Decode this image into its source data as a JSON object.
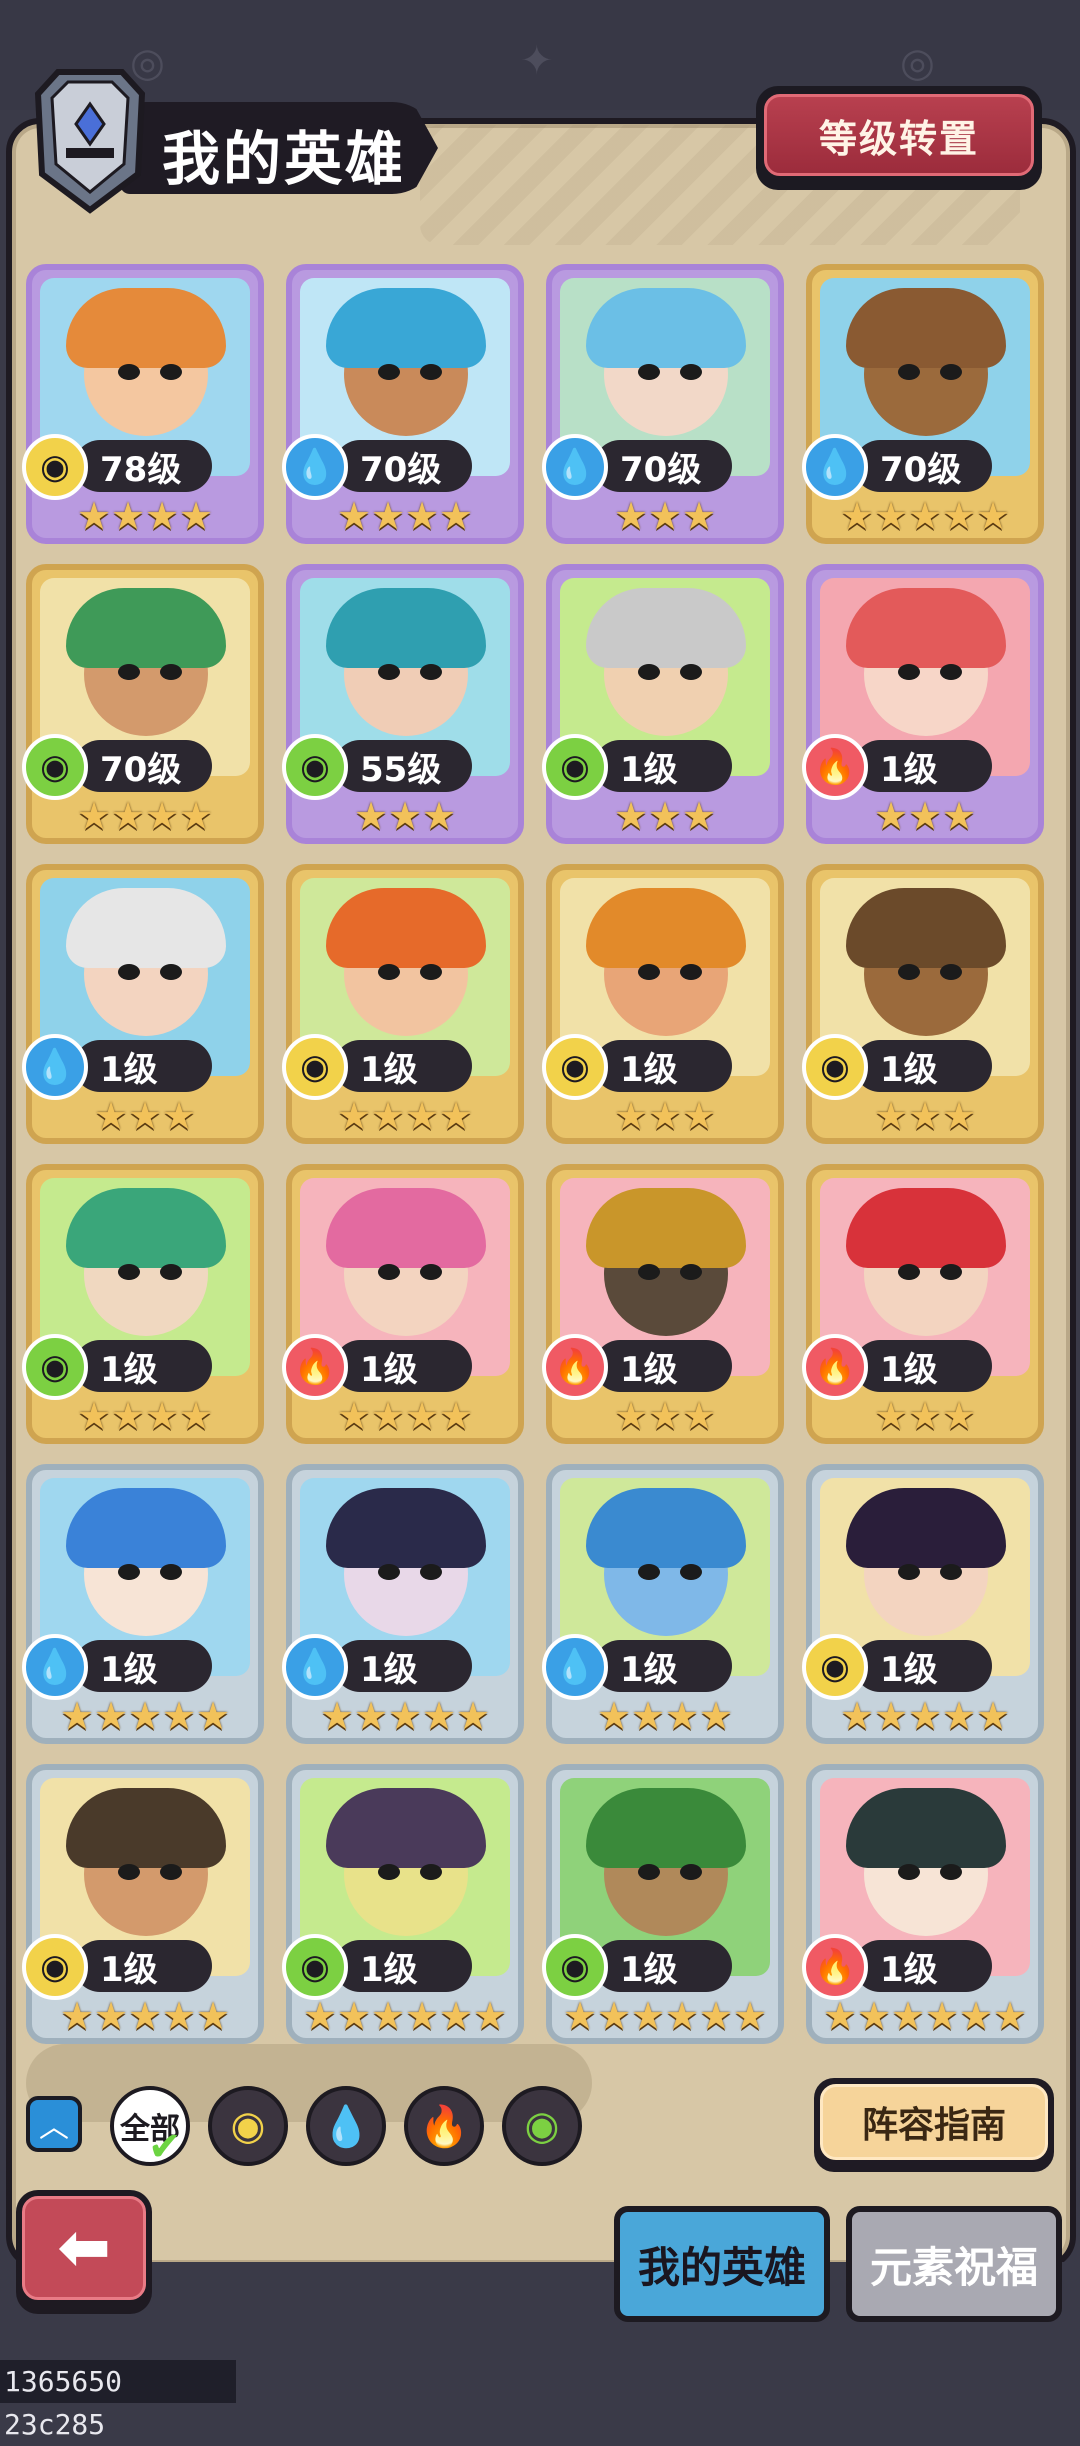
{
  "header": {
    "title": "我的英雄",
    "level_transfer_label": "等级转置"
  },
  "heroes": [
    {
      "level": "78级",
      "element": "earth",
      "stars": 4,
      "frame": "purple",
      "colors": {
        "bg": "#9fd7ef",
        "hair": "#e58a3a",
        "skin": "#f4c7a0"
      }
    },
    {
      "level": "70级",
      "element": "water",
      "stars": 4,
      "frame": "purple",
      "colors": {
        "bg": "#bfe6f6",
        "hair": "#39a7d6",
        "skin": "#c98a5a"
      }
    },
    {
      "level": "70级",
      "element": "water",
      "stars": 3,
      "frame": "purple",
      "colors": {
        "bg": "#b8e0c7",
        "hair": "#6bbfe6",
        "skin": "#f2d8c8"
      }
    },
    {
      "level": "70级",
      "element": "water",
      "stars": 5,
      "frame": "gold",
      "colors": {
        "bg": "#8fd2ea",
        "hair": "#8a5a32",
        "skin": "#9b6a3c"
      }
    },
    {
      "level": "70级",
      "element": "wood",
      "stars": 4,
      "frame": "gold",
      "colors": {
        "bg": "#f1e1a8",
        "hair": "#3f9a58",
        "skin": "#d39a6c"
      }
    },
    {
      "level": "55级",
      "element": "wood",
      "stars": 3,
      "frame": "purple",
      "colors": {
        "bg": "#9fdde9",
        "hair": "#2f9fb0",
        "skin": "#f0cdb6"
      }
    },
    {
      "level": "1级",
      "element": "wood",
      "stars": 3,
      "frame": "purple",
      "colors": {
        "bg": "#c5ea8e",
        "hair": "#c9c9c9",
        "skin": "#f0d0b0"
      }
    },
    {
      "level": "1级",
      "element": "fire",
      "stars": 3,
      "frame": "purple",
      "colors": {
        "bg": "#f4a7b0",
        "hair": "#e35a5a",
        "skin": "#f7d6c8"
      }
    },
    {
      "level": "1级",
      "element": "water",
      "stars": 3,
      "frame": "gold",
      "colors": {
        "bg": "#8fd2ea",
        "hair": "#e6e6e6",
        "skin": "#f3d4c0"
      }
    },
    {
      "level": "1级",
      "element": "earth",
      "stars": 4,
      "frame": "gold",
      "colors": {
        "bg": "#cfe89a",
        "hair": "#e66a2a",
        "skin": "#f2c4a0"
      }
    },
    {
      "level": "1级",
      "element": "earth",
      "stars": 3,
      "frame": "gold",
      "colors": {
        "bg": "#f1e1a8",
        "hair": "#e28a2a",
        "skin": "#e8a577"
      }
    },
    {
      "level": "1级",
      "element": "earth",
      "stars": 3,
      "frame": "gold",
      "colors": {
        "bg": "#f1e1a8",
        "hair": "#6b4a2a",
        "skin": "#9b6a3c"
      }
    },
    {
      "level": "1级",
      "element": "wood",
      "stars": 4,
      "frame": "gold",
      "colors": {
        "bg": "#c5ea8e",
        "hair": "#3aa67a",
        "skin": "#f0d8c0"
      }
    },
    {
      "level": "1级",
      "element": "fire",
      "stars": 4,
      "frame": "gold",
      "colors": {
        "bg": "#f6b4bc",
        "hair": "#e36aa0",
        "skin": "#f3d4c0"
      }
    },
    {
      "level": "1级",
      "element": "fire",
      "stars": 3,
      "frame": "gold",
      "colors": {
        "bg": "#f6b4bc",
        "hair": "#c9962a",
        "skin": "#5a4a3a"
      }
    },
    {
      "level": "1级",
      "element": "fire",
      "stars": 3,
      "frame": "gold",
      "colors": {
        "bg": "#f6b4bc",
        "hair": "#d8323a",
        "skin": "#f3d4c0"
      }
    },
    {
      "level": "1级",
      "element": "water",
      "stars": 5,
      "frame": "silver",
      "colors": {
        "bg": "#9fd7ef",
        "hair": "#3a82d8",
        "skin": "#f7e4d6"
      }
    },
    {
      "level": "1级",
      "element": "water",
      "stars": 5,
      "frame": "silver",
      "colors": {
        "bg": "#9fd7ef",
        "hair": "#2a2a4a",
        "skin": "#e8d8e8"
      }
    },
    {
      "level": "1级",
      "element": "water",
      "stars": 4,
      "frame": "silver",
      "colors": {
        "bg": "#cfe89a",
        "hair": "#3a8ad0",
        "skin": "#7fb8e8"
      }
    },
    {
      "level": "1级",
      "element": "earth",
      "stars": 5,
      "frame": "silver",
      "colors": {
        "bg": "#f1e1a8",
        "hair": "#2a1e3a",
        "skin": "#f3d4c0"
      }
    },
    {
      "level": "1级",
      "element": "earth",
      "stars": 5,
      "frame": "silver",
      "colors": {
        "bg": "#f1e1a8",
        "hair": "#4a3a2a",
        "skin": "#d39a6c"
      }
    },
    {
      "level": "1级",
      "element": "wood",
      "stars": 6,
      "frame": "silver",
      "colors": {
        "bg": "#c5ea8e",
        "hair": "#4a3a5a",
        "skin": "#e8e28a"
      }
    },
    {
      "level": "1级",
      "element": "wood",
      "stars": 6,
      "frame": "silver",
      "colors": {
        "bg": "#8fd27a",
        "hair": "#3a8a3a",
        "skin": "#b0895a"
      }
    },
    {
      "level": "1级",
      "element": "fire",
      "stars": 6,
      "frame": "silver",
      "colors": {
        "bg": "#f6b4bc",
        "hair": "#2a3a3a",
        "skin": "#f7e4d6"
      }
    }
  ],
  "element_colors": {
    "earth": "#f2d24a",
    "water": "#3aa0e6",
    "wood": "#7cd042",
    "fire": "#f05a64"
  },
  "element_icons": {
    "earth": "earth-swirl-icon",
    "water": "water-drop-icon",
    "wood": "wood-swirl-icon",
    "fire": "fire-flame-icon"
  },
  "filters": {
    "all_label": "全部",
    "items": [
      "earth",
      "water",
      "fire",
      "wood"
    ]
  },
  "guide_label": "阵容指南",
  "tabs": {
    "my_heroes": "我的英雄",
    "element_blessing": "元素祝福"
  },
  "footer_id": "1365650 23c285"
}
